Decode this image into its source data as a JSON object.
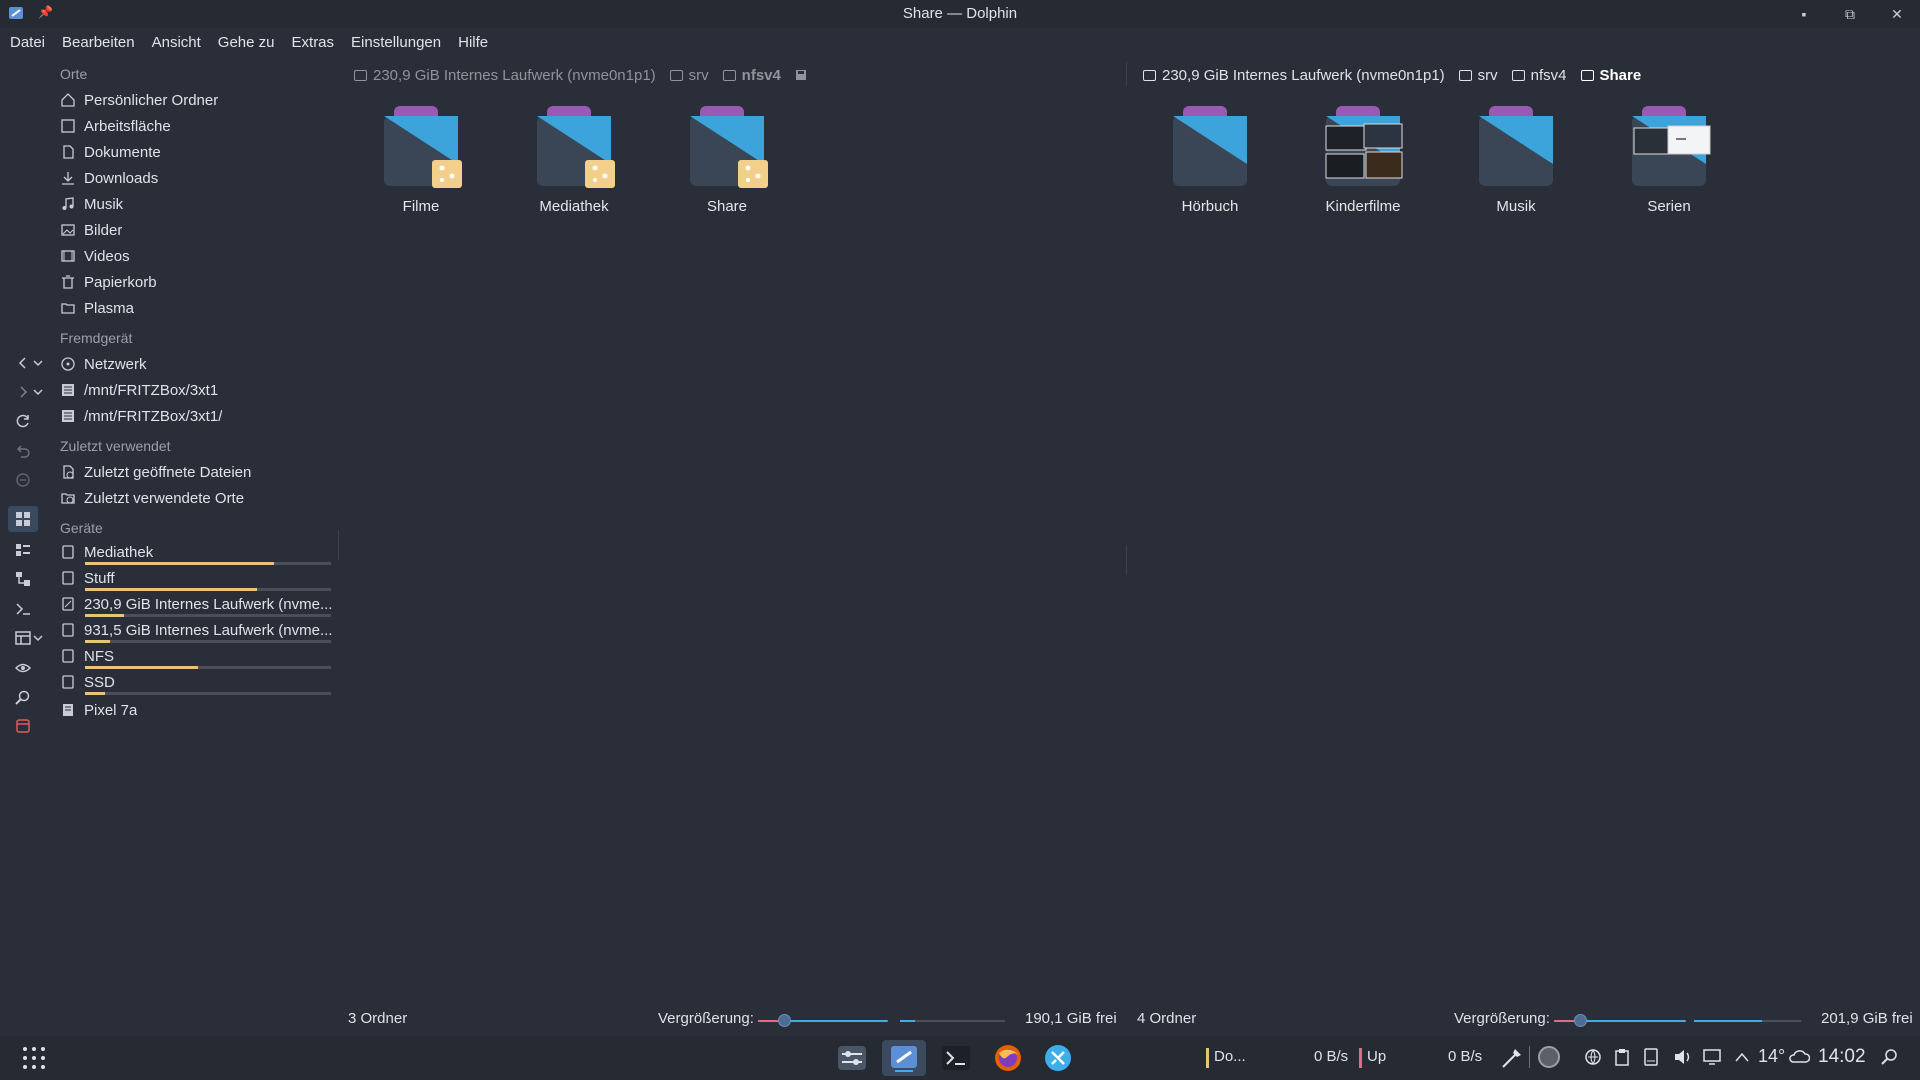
{
  "window": {
    "title": "Share — Dolphin"
  },
  "menu": [
    "Datei",
    "Bearbeiten",
    "Ansicht",
    "Gehe zu",
    "Extras",
    "Einstellungen",
    "Hilfe"
  ],
  "sidebar": {
    "sections": {
      "places": "Orte",
      "remote": "Fremdgerät",
      "recent": "Zuletzt verwendet",
      "devices": "Geräte"
    },
    "places": [
      {
        "label": "Persönlicher Ordner",
        "icon": "home-icon"
      },
      {
        "label": "Arbeitsfläche",
        "icon": "desktop-icon"
      },
      {
        "label": "Dokumente",
        "icon": "documents-icon"
      },
      {
        "label": "Downloads",
        "icon": "download-icon"
      },
      {
        "label": "Musik",
        "icon": "music-icon"
      },
      {
        "label": "Bilder",
        "icon": "pictures-icon"
      },
      {
        "label": "Videos",
        "icon": "videos-icon"
      },
      {
        "label": "Papierkorb",
        "icon": "trash-icon"
      },
      {
        "label": "Plasma",
        "icon": "folder-icon"
      }
    ],
    "remote": [
      {
        "label": "Netzwerk",
        "icon": "network-icon"
      },
      {
        "label": "/mnt/FRITZBox/3xt1",
        "icon": "network-drive-icon"
      },
      {
        "label": "/mnt/FRITZBox/3xt1/",
        "icon": "network-drive-icon"
      }
    ],
    "recent": [
      {
        "label": "Zuletzt geöffnete Dateien",
        "icon": "recent-files-icon"
      },
      {
        "label": "Zuletzt verwendete Orte",
        "icon": "recent-places-icon"
      }
    ],
    "devices": [
      {
        "label": "Mediathek",
        "usage": 0.77,
        "icon": "drive-icon"
      },
      {
        "label": "Stuff",
        "usage": 0.7,
        "icon": "drive-icon"
      },
      {
        "label": "230,9 GiB Internes Laufwerk (nvme...",
        "usage": 0.16,
        "icon": "drive-icon"
      },
      {
        "label": "931,5 GiB Internes Laufwerk (nvme...",
        "usage": 0.1,
        "icon": "drive-icon"
      },
      {
        "label": "NFS",
        "usage": 0.46,
        "icon": "drive-icon"
      },
      {
        "label": "SSD",
        "usage": 0.08,
        "icon": "drive-icon"
      },
      {
        "label": "Pixel 7a",
        "usage": null,
        "icon": "phone-icon"
      }
    ]
  },
  "left_pane": {
    "breadcrumbs": [
      "230,9 GiB Internes Laufwerk (nvme0n1p1)",
      "srv",
      "nfsv4"
    ],
    "folders": [
      "Filme",
      "Mediathek",
      "Share"
    ],
    "status": "3 Ordner",
    "zoom_label": "Vergrößerung:",
    "free": "190,1 GiB frei",
    "zoom_level": 0.2
  },
  "right_pane": {
    "breadcrumbs": [
      "230,9 GiB Internes Laufwerk (nvme0n1p1)",
      "srv",
      "nfsv4",
      "Share"
    ],
    "folders": [
      "Hörbuch",
      "Kinderfilme",
      "Musik",
      "Serien"
    ],
    "status": "4 Ordner",
    "zoom_label": "Vergrößerung:",
    "free": "201,9 GiB frei",
    "zoom_level": 0.2
  },
  "taskbar": {
    "task_label": "Do...",
    "net_down": "0 B/s",
    "net_up_label": "Up",
    "net_up": "0 B/s",
    "temperature": "14°",
    "clock": "14:02"
  },
  "colors": {
    "accent": "#3daee9",
    "usage": "#e8c37a",
    "folder_top": "#9b59b6",
    "folder_front": "#3a4656"
  }
}
